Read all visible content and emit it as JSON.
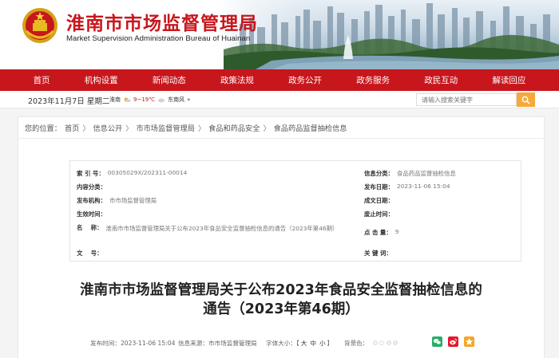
{
  "header": {
    "site_title": "淮南市市场监督管理局",
    "site_subtitle": "Market Supervision Administration Bureau of Huainan"
  },
  "nav": {
    "items": [
      "首页",
      "机构设置",
      "新闻动态",
      "政策法规",
      "政务公开",
      "政务服务",
      "政民互动",
      "解读回应"
    ]
  },
  "infobar": {
    "date": "2023年11月7日",
    "weekday": "星期二",
    "weather_city": "淮南",
    "weather_temp": "9~19℃",
    "weather_wind": "东南风",
    "weather_more": "»",
    "search_placeholder": "请输入搜索关键字"
  },
  "breadcrumb": {
    "prefix": "您的位置：",
    "items": [
      "首页",
      "信息公开",
      "市市场监督管理局",
      "食品和药品安全",
      "食品药品监督抽检信息"
    ]
  },
  "meta": {
    "index_label": "索 引 号：",
    "index_value": "00305029X/202311-00014",
    "category_label": "信息分类：",
    "category_value": "食品药品监督抽检信息",
    "content_label": "内容分类：",
    "content_value": "",
    "pubdate_label": "发布日期：",
    "pubdate_value": "2023-11-06 15:04",
    "org_label": "发布机构：",
    "org_value": "市市场监督管理局",
    "formdate_label": "成文日期：",
    "formdate_value": "",
    "effective_label": "生效时间：",
    "effective_value": "",
    "expire_label": "废止时间：",
    "expire_value": "",
    "name_label": "名    称：",
    "name_value": "淮南市市场监督管理局关于公布2023年食品安全监督抽检信息的通告（2023年第46期）",
    "views_label": "点 击 量：",
    "views_value": "9",
    "docno_label": "文    号：",
    "docno_value": "",
    "keywords_label": "关 键 词：",
    "keywords_value": ""
  },
  "article": {
    "title_line1": "淮南市市场监督管理局关于公布2023年食品安全监督抽检信息的",
    "title_line2": "通告（2023年第46期）",
    "pub_time": "发布时间：2023-11-06 15:04",
    "source": "信息来源：市市场监督管理局",
    "font_size_label": "字体大小：",
    "font_open": "【",
    "font_large": "大",
    "font_medium": "中",
    "font_small": "小",
    "font_close": "】",
    "bg_label": "背景色："
  },
  "colors": {
    "brand_red": "#c8161d",
    "search_orange": "#f6a93b",
    "wechat_green": "#2aae67",
    "weibo_red": "#e6162d",
    "qzone_yellow": "#f5a623"
  }
}
